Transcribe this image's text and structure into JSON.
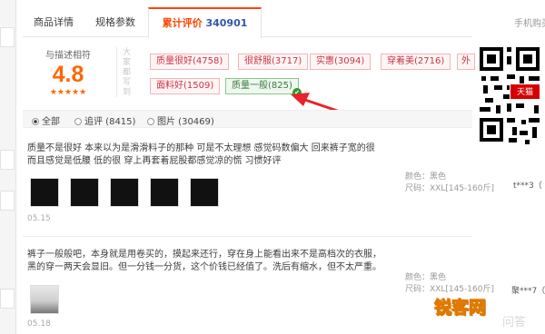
{
  "tabs": [
    {
      "label": "商品详情"
    },
    {
      "label": "规格参数"
    },
    {
      "label": "累计评价",
      "count": "340901"
    }
  ],
  "right_tab": "手机购买",
  "rating": {
    "label": "与描述相符",
    "score": "4.8",
    "stars": "★★★★★"
  },
  "impression_label": "大家都写到",
  "tags": [
    {
      "label": "质量很好(4758)"
    },
    {
      "label": "很舒服(3717)"
    },
    {
      "label": "实惠(3094)"
    },
    {
      "label": "穿着美(2716)"
    },
    {
      "label": "外"
    },
    {
      "label": "面料好(1509)"
    },
    {
      "label": "质量一般(825)"
    }
  ],
  "filters": [
    {
      "label": "全部",
      "selected": true
    },
    {
      "label": "追评 (8415)",
      "selected": false
    },
    {
      "label": "图片 (30469)",
      "selected": false
    }
  ],
  "reviews": [
    {
      "text": "质量不是很好 本来以为是滑滑料子的那种 可是不太理想 感觉码数偏大 回来裤子宽的很 而且感觉是低腰 低的很 穿上再套着屁股都感觉凉的慌 习惯好评",
      "date": "05.15",
      "color_line": "颜色：黑色",
      "size_line": "尺码：XXL[145-160斤]",
      "user": "t***3（"
    },
    {
      "text": "裤子一般般吧，本身就是用卷买的，摸起来还行，穿在身上能看出来不是高档次的衣服，黑的穿一两天会显旧。但一分钱一分货，这个价钱已经值了。洗后有缩水，但不太严重。",
      "date": "05.18",
      "color_line": "颜色：黑色",
      "size_line": "尺码：XXL[145-160斤]",
      "user": "聚***7（"
    }
  ],
  "overlay": {
    "badge": "天猫",
    "watermark": "锐客网",
    "watermark_sub": "问答"
  },
  "colors": {
    "accent": "#ff4400",
    "tag_red": "#cc3344",
    "tag_green": "#3a7a3a",
    "arrow": "#e8232a"
  },
  "icons": {
    "check": "check-icon",
    "qr": "qr-code"
  }
}
